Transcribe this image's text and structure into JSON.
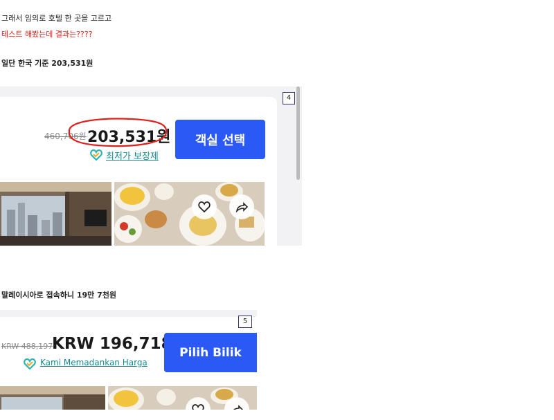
{
  "caption": {
    "line1": "그래서 임의로 호텔 한 곳을 고르고",
    "line2": "테스트 해봤는데 결과는????",
    "line3": "일단 한국 기준 203,531원",
    "line4": "말레이시아로 접속하니 19만 7천원"
  },
  "shot1": {
    "badge": "4",
    "old_price": "460,706원",
    "price": "203,531원",
    "cta": "객실 선택",
    "guarantee": "최저가 보장제"
  },
  "shot2": {
    "badge": "5",
    "old_price": "KRW 488,197",
    "price": "KRW 196,718",
    "cta": "Pilih Bilik",
    "guarantee": "Kami Memadankan Harga"
  },
  "icons": [
    "heart-icon",
    "share-icon",
    "heart-check-icon"
  ],
  "colors": {
    "accent": "#2b59f6",
    "guarantee": "#168a8a",
    "annotation": "#e0201b"
  }
}
